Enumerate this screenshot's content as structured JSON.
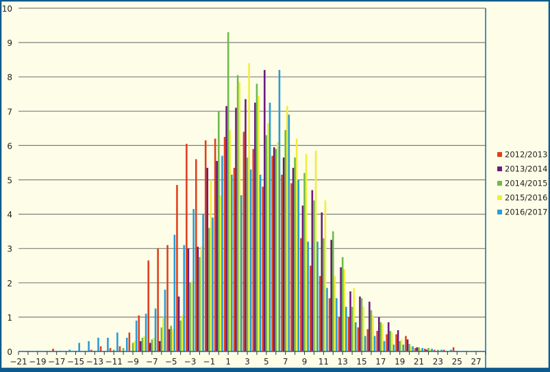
{
  "chart_data": {
    "type": "bar",
    "title": "",
    "xlabel": "",
    "ylabel": "",
    "ylim": [
      0,
      10
    ],
    "xlim": [
      -21,
      28
    ],
    "x_ticks": [
      -21,
      -19,
      -17,
      -15,
      -13,
      -11,
      -9,
      -7,
      -5,
      -3,
      -1,
      1,
      3,
      5,
      7,
      9,
      11,
      13,
      15,
      17,
      19,
      21,
      23,
      25,
      27
    ],
    "x_tick_labels": [
      "−21",
      "−19",
      "−17",
      "−15",
      "−13",
      "−11",
      "−9",
      "−7",
      "−5",
      "−3",
      "−1",
      "1",
      "3",
      "5",
      "7",
      "9",
      "11",
      "13",
      "15",
      "17",
      "19",
      "21",
      "23",
      "25",
      "27"
    ],
    "y_ticks": [
      0,
      1,
      2,
      3,
      4,
      5,
      6,
      7,
      8,
      9,
      10
    ],
    "y_tick_labels": [
      "0",
      "1",
      "2",
      "3",
      "4",
      "5",
      "6",
      "7",
      "8",
      "9",
      "10"
    ],
    "grid": true,
    "legend_position": "right",
    "colors": {
      "plot_background": "#fdfde8",
      "grid": "#7f7f7f",
      "frame": "#0e5a8e",
      "axis": "#1f6fb0"
    },
    "x": [
      -21,
      -20,
      -19,
      -18,
      -17,
      -16,
      -15,
      -14,
      -13,
      -12,
      -11,
      -10,
      -9,
      -8,
      -7,
      -6,
      -5,
      -4,
      -3,
      -2,
      -1,
      0,
      1,
      2,
      3,
      4,
      5,
      6,
      7,
      8,
      9,
      10,
      11,
      12,
      13,
      14,
      15,
      16,
      17,
      18,
      19,
      20,
      21,
      22,
      23,
      24,
      25,
      26,
      27
    ],
    "series": [
      {
        "name": "2012/2013",
        "color": "#e0401c",
        "values": [
          0,
          0,
          0,
          0,
          0.08,
          0,
          0,
          0,
          0.05,
          0.15,
          0.1,
          0.15,
          0.55,
          1.05,
          2.65,
          3.0,
          3.1,
          4.85,
          6.05,
          5.6,
          6.15,
          6.2,
          6.25,
          5.35,
          6.4,
          5.9,
          4.8,
          5.7,
          5.15,
          4.9,
          3.3,
          2.5,
          2.2,
          1.55,
          1.0,
          1.0,
          0.7,
          0.65,
          0.6,
          0.5,
          0.5,
          0.45,
          0.1,
          0.08,
          0.05,
          0.05,
          0.12,
          0,
          0
        ]
      },
      {
        "name": "2013/2014",
        "color": "#6a1d7a",
        "values": [
          0,
          0,
          0,
          0,
          0,
          0,
          0,
          0,
          0,
          0,
          0,
          0,
          0,
          0.3,
          0.25,
          0.3,
          0.65,
          1.6,
          3.0,
          3.05,
          5.35,
          5.55,
          7.15,
          7.1,
          7.35,
          7.25,
          8.2,
          5.95,
          5.65,
          5.35,
          4.25,
          4.7,
          4.05,
          3.25,
          2.45,
          1.75,
          1.6,
          1.45,
          1.0,
          0.85,
          0.62,
          0.35,
          0.12,
          0.05,
          0,
          0,
          0,
          0,
          0
        ]
      },
      {
        "name": "2014/2015",
        "color": "#6dbb4a",
        "values": [
          0,
          0,
          0,
          0,
          0,
          0,
          0,
          0,
          0,
          0,
          0.05,
          0.1,
          0.25,
          0.4,
          0.35,
          0.7,
          0.75,
          0.9,
          2.0,
          2.75,
          3.6,
          7.0,
          9.3,
          8.05,
          5.65,
          7.8,
          6.3,
          5.9,
          6.45,
          5.65,
          5.2,
          4.4,
          3.3,
          3.5,
          2.75,
          1.3,
          1.55,
          1.2,
          0.85,
          0.6,
          0.3,
          0.22,
          0.12,
          0.1,
          0.05,
          0,
          0,
          0,
          0
        ]
      },
      {
        "name": "2015/2016",
        "color": "#f0ee3a",
        "values": [
          0,
          0,
          0,
          0,
          0,
          0,
          0,
          0,
          0,
          0,
          0,
          0,
          0.3,
          0.45,
          0.4,
          1.0,
          0.65,
          1.05,
          2.05,
          3.05,
          5.0,
          4.55,
          6.45,
          7.85,
          8.4,
          7.45,
          6.65,
          6.1,
          7.15,
          6.2,
          5.75,
          5.85,
          4.4,
          2.2,
          2.4,
          1.85,
          1.3,
          1.05,
          0.8,
          0.55,
          0.35,
          0.15,
          0.08,
          0.05,
          0,
          0,
          0,
          0,
          0
        ]
      },
      {
        "name": "2016/2017",
        "color": "#2a9cd6",
        "values": [
          0,
          0,
          0,
          0,
          0.02,
          0.05,
          0.25,
          0.3,
          0.4,
          0.4,
          0.55,
          0.4,
          0.9,
          1.1,
          1.25,
          1.8,
          3.4,
          3.1,
          4.15,
          4.0,
          3.9,
          5.7,
          5.15,
          4.55,
          5.3,
          5.15,
          7.25,
          8.2,
          6.9,
          5.0,
          3.2,
          3.2,
          1.85,
          1.55,
          1.3,
          0.85,
          0.45,
          0.45,
          0.3,
          0.2,
          0.2,
          0.15,
          0.1,
          0.08,
          0.05,
          0.05,
          0,
          0,
          0
        ]
      }
    ]
  }
}
